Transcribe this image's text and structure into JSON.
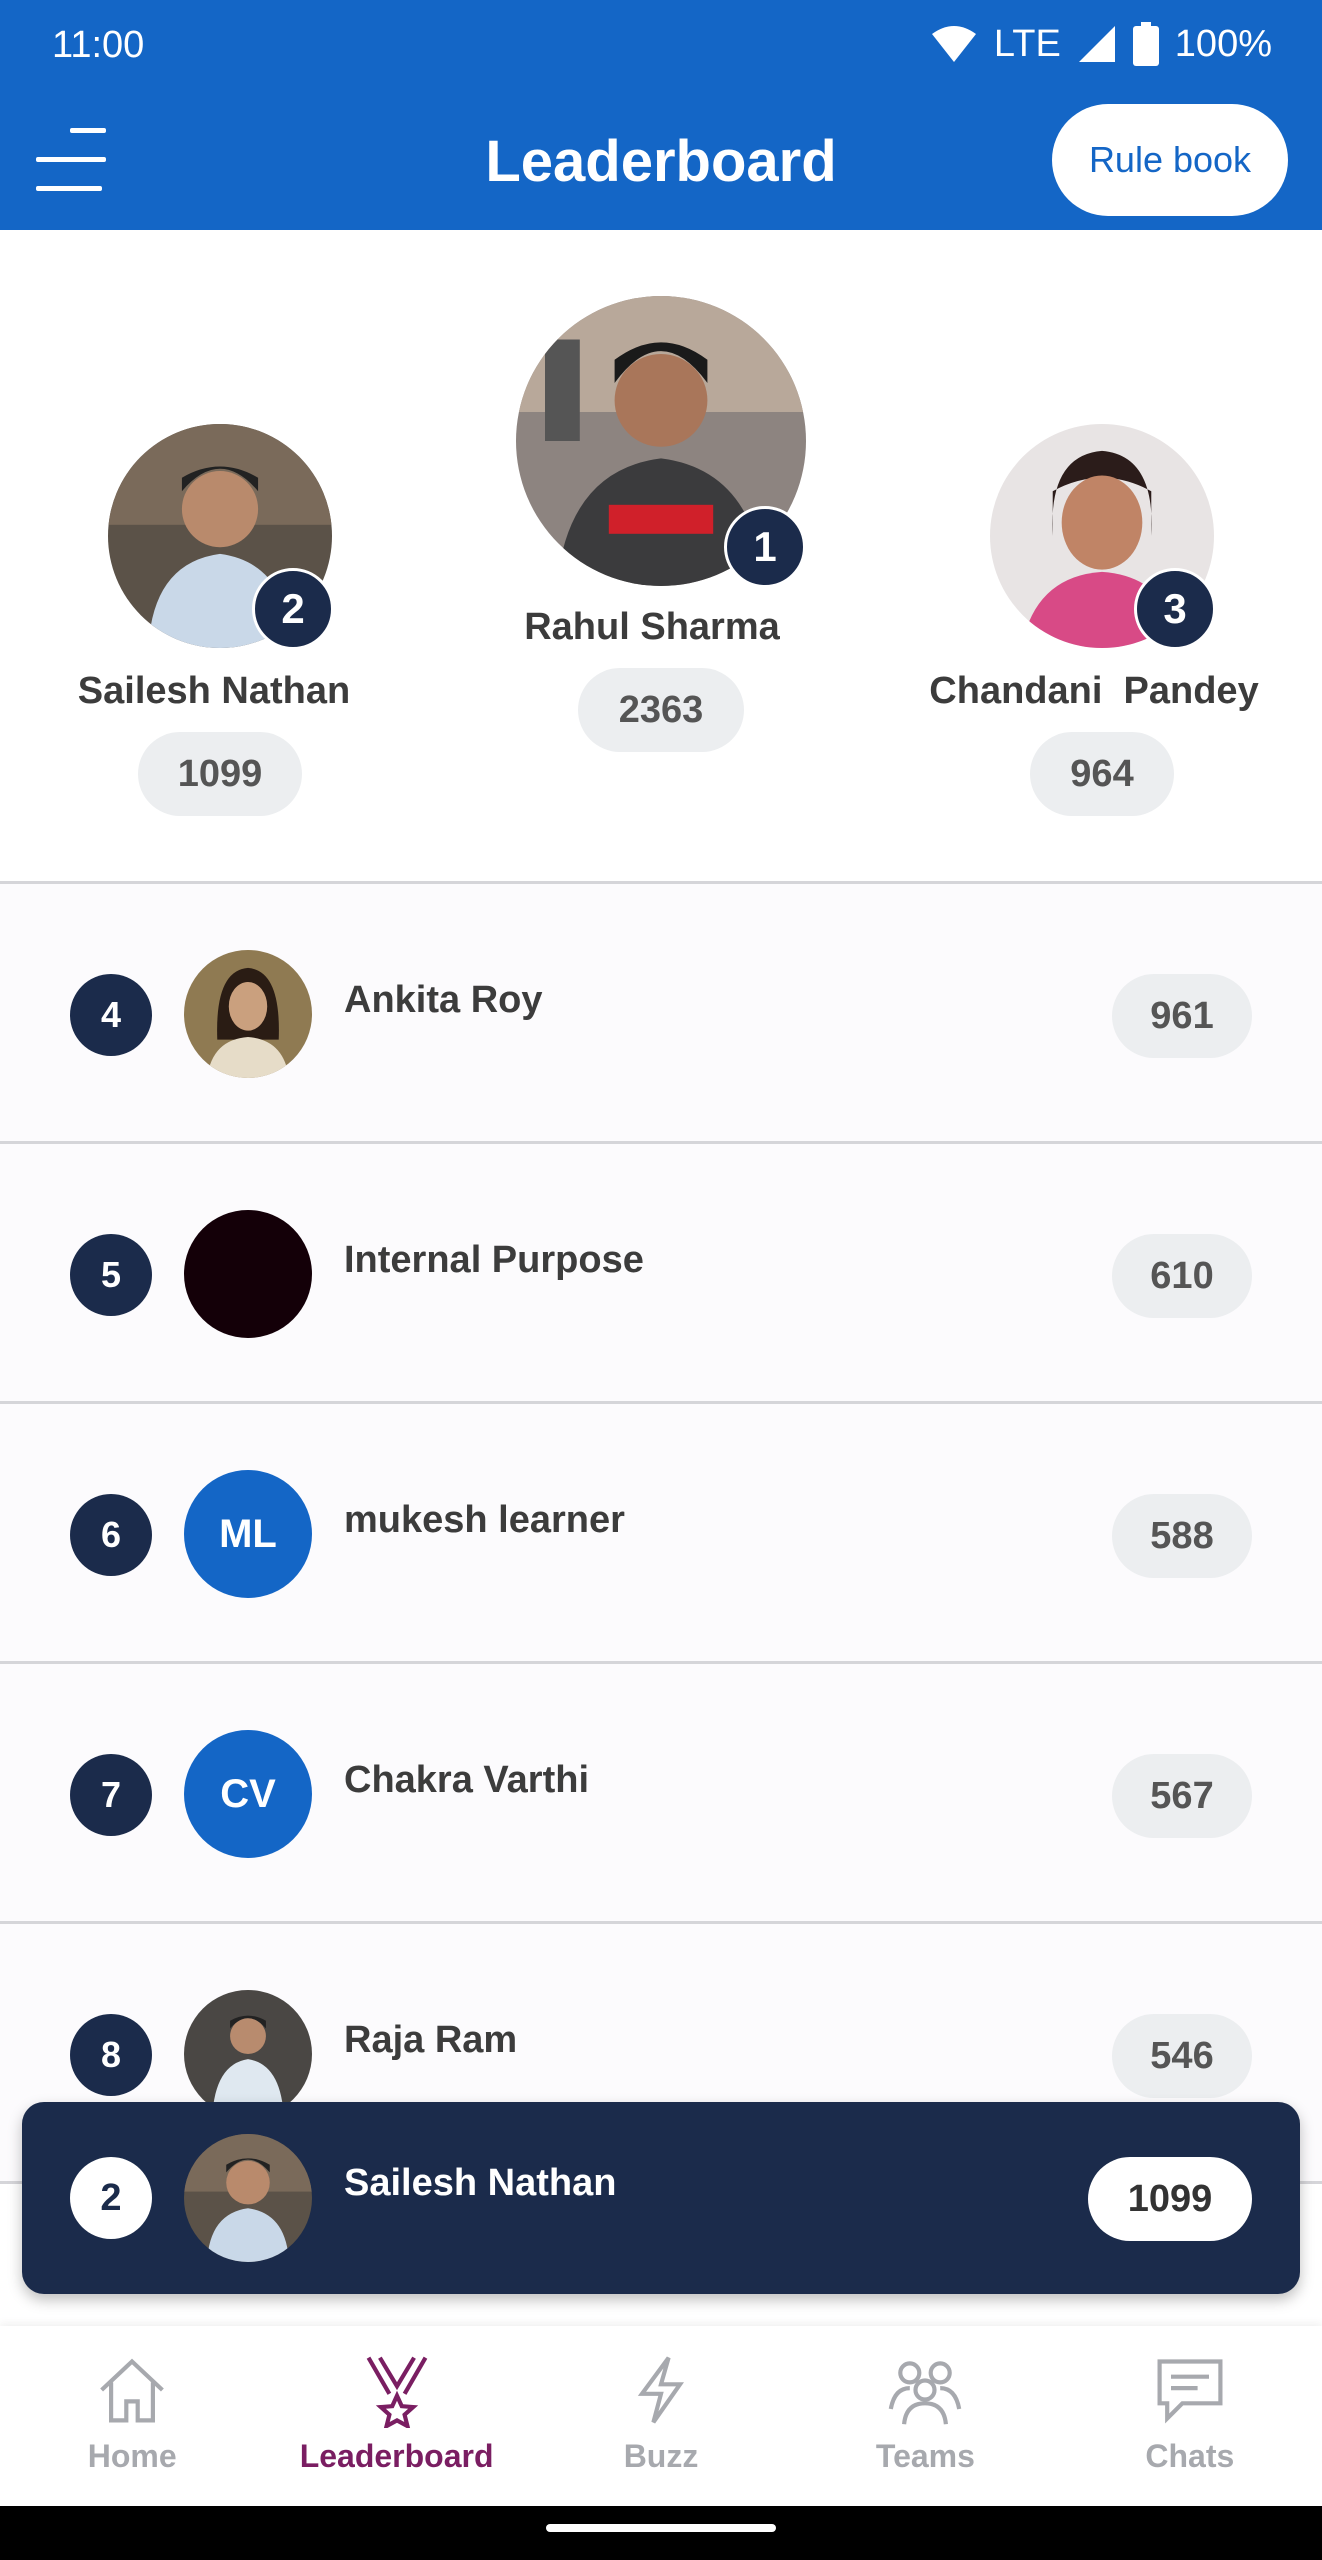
{
  "status_bar": {
    "time": "11:00",
    "network": "LTE",
    "battery": "100%"
  },
  "header": {
    "title": "Leaderboard",
    "rule_book_label": "Rule book",
    "menu_icon": "hamburger-menu-icon"
  },
  "podium": [
    {
      "rank": "2",
      "name": "Sailesh Nathan",
      "score": "1099",
      "avatar": "photo"
    },
    {
      "rank": "1",
      "name": "Rahul Sharma",
      "score": "2363",
      "avatar": "photo"
    },
    {
      "rank": "3",
      "name": "Chandani  Pandey",
      "score": "964",
      "avatar": "photo"
    }
  ],
  "list": [
    {
      "rank": "4",
      "name": "Ankita Roy",
      "score": "961",
      "avatar": "photo"
    },
    {
      "rank": "5",
      "name": "Internal Purpose",
      "score": "610",
      "avatar": "dark-circle"
    },
    {
      "rank": "6",
      "name": "mukesh learner",
      "score": "588",
      "initials": "ML"
    },
    {
      "rank": "7",
      "name": "Chakra Varthi",
      "score": "567",
      "initials": "CV"
    },
    {
      "rank": "8",
      "name": "Raja Ram",
      "score": "546",
      "avatar": "photo"
    }
  ],
  "my_rank": {
    "rank": "2",
    "name": "Sailesh Nathan",
    "score": "1099"
  },
  "bottom_nav": [
    {
      "label": "Home",
      "icon": "home-icon",
      "active": false
    },
    {
      "label": "Leaderboard",
      "icon": "medal-icon",
      "active": true
    },
    {
      "label": "Buzz",
      "icon": "lightning-icon",
      "active": false
    },
    {
      "label": "Teams",
      "icon": "people-icon",
      "active": false
    },
    {
      "label": "Chats",
      "icon": "chat-icon",
      "active": false
    }
  ],
  "colors": {
    "primary": "#1466c6",
    "rank_badge": "#1b2b4b",
    "active_nav": "#7a1e62",
    "score_pill": "#eceef0"
  }
}
